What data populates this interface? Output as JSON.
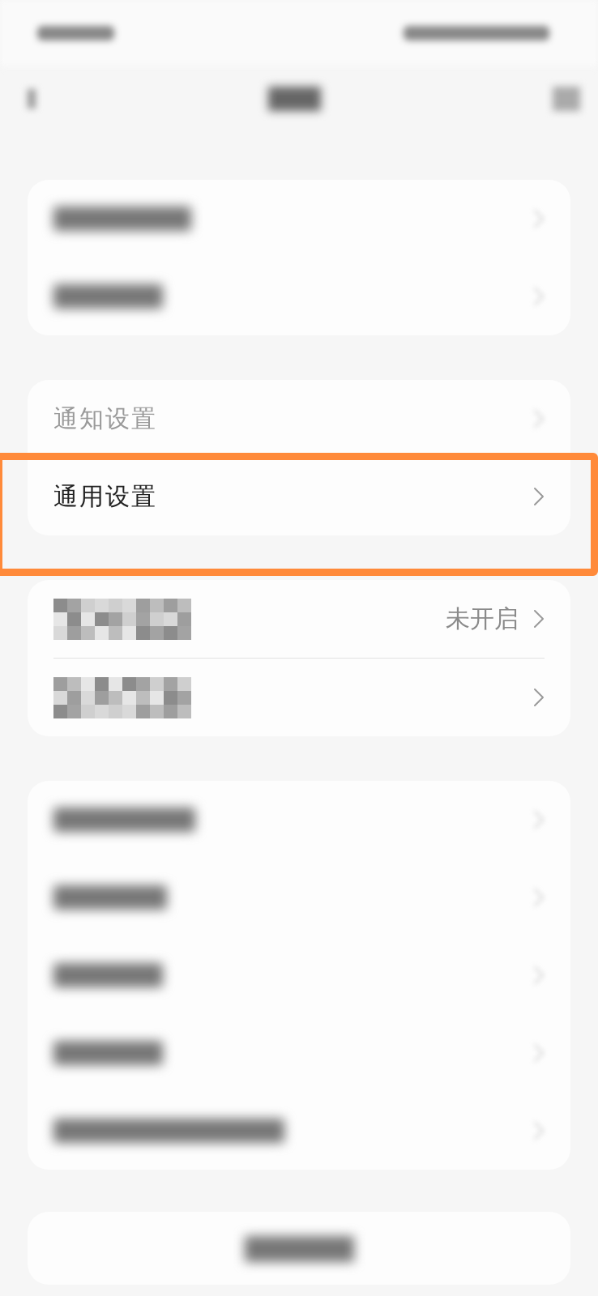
{
  "groups": [
    {
      "rows": [
        {
          "kind": "blurred"
        },
        {
          "kind": "blurred"
        }
      ]
    },
    {
      "rows": [
        {
          "kind": "label",
          "label": "通知设置",
          "faded": true,
          "highlighted": false
        },
        {
          "kind": "label",
          "label": "通用设置",
          "faded": false,
          "highlighted": true
        }
      ]
    },
    {
      "rows": [
        {
          "kind": "pixelated",
          "value": "未开启"
        },
        {
          "kind": "pixelated"
        }
      ]
    },
    {
      "rows": [
        {
          "kind": "blurred"
        },
        {
          "kind": "blurred"
        },
        {
          "kind": "blurred"
        },
        {
          "kind": "blurred"
        },
        {
          "kind": "blurred"
        }
      ]
    }
  ]
}
